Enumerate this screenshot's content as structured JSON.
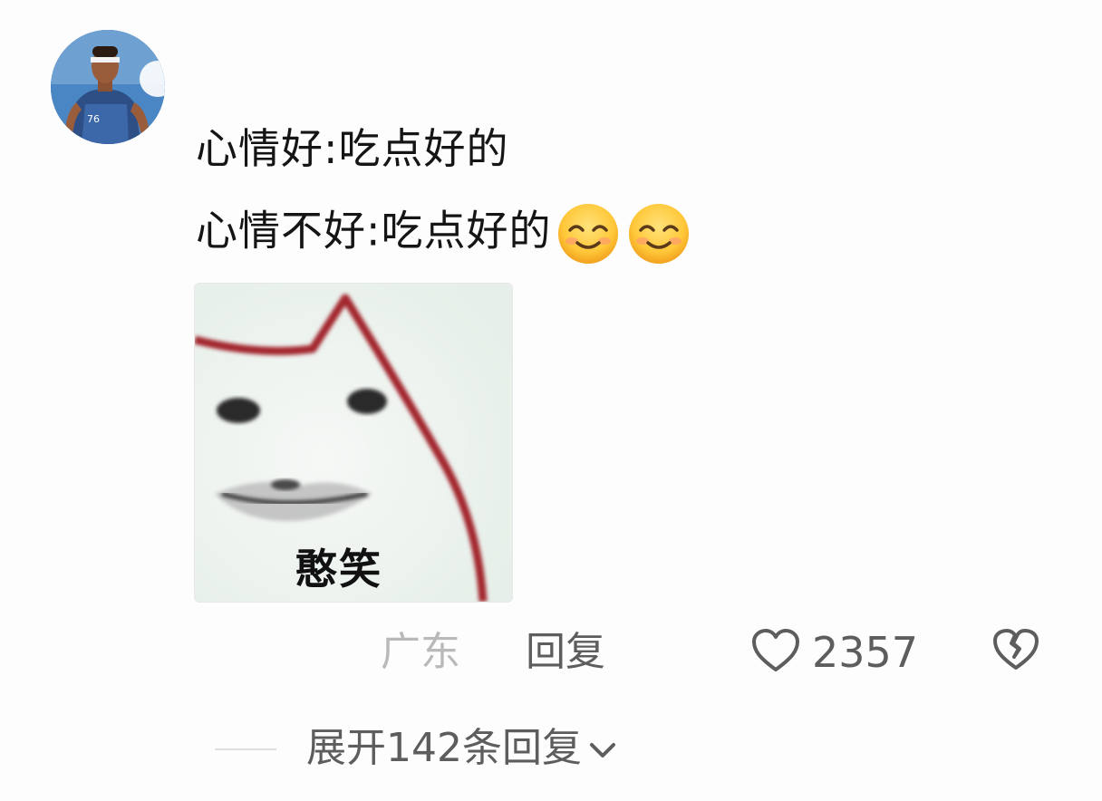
{
  "comment": {
    "avatar_icon": "user-avatar-basketball-player",
    "lines": [
      "心情好:吃点好的",
      "心情不好:吃点好的"
    ],
    "emojis": [
      "smiling-face-icon",
      "smiling-face-icon"
    ],
    "sticker": {
      "caption": "憨笑"
    }
  },
  "meta": {
    "location": "广东",
    "reply_label": "回复",
    "like_count": "2357",
    "like_icon": "heart-outline-icon",
    "dislike_icon": "broken-heart-icon"
  },
  "replies": {
    "expand_label": "展开142条回复",
    "chevron_icon": "chevron-down-icon"
  },
  "colors": {
    "text_primary": "#151515",
    "text_secondary": "#5d5d5d",
    "text_muted": "#b9b9b9",
    "sticker_outline": "#a3282e"
  }
}
